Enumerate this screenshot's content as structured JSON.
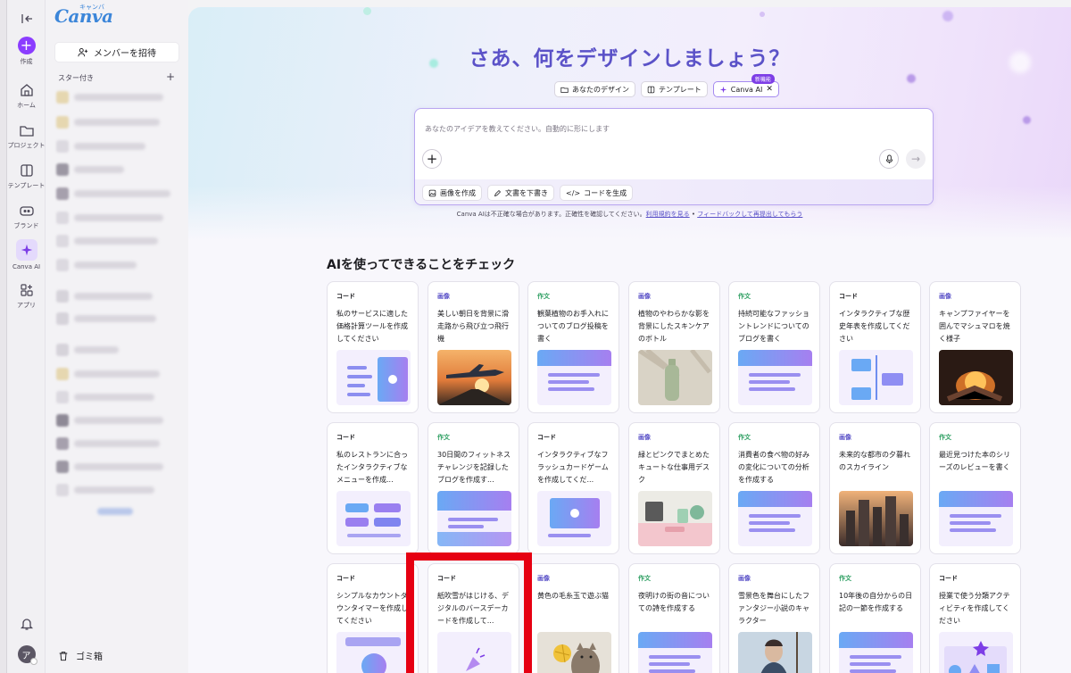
{
  "rail": {
    "create": "作成",
    "home": "ホーム",
    "projects": "プロジェクト",
    "templates": "テンプレート",
    "brand": "ブランド",
    "canva_ai": "Canva AI",
    "apps": "アプリ",
    "avatar_initial": "ア"
  },
  "panel": {
    "logo": "Canva",
    "logo_kana": "キャンバ",
    "invite": "メンバーを招待",
    "starred": "スター付き",
    "trash": "ゴミ箱"
  },
  "main": {
    "title": "さあ、何をデザインしましょう？",
    "chips": [
      {
        "label": "あなたのデザイン"
      },
      {
        "label": "テンプレート"
      },
      {
        "label": "Canva AI",
        "badge": "新機能"
      }
    ],
    "prompt": {
      "placeholder": "あなたのアイデアを教えてください。自動的に形にします",
      "tools": [
        "画像を作成",
        "文書を下書き",
        "コードを生成"
      ]
    },
    "disclaimer": {
      "text": "Canva AIは不正確な場合があります。正確性を確認してください。",
      "link1": "利用規約を見る",
      "sep": " • ",
      "link2": "フィードバックして再提出してもらう"
    },
    "section_title": "AIを使ってできることをチェック"
  },
  "colors": {
    "accent": "#8b3dff",
    "title": "#5b52c8",
    "code": "#1b1b1f",
    "image": "#5b52c8",
    "doc": "#2a9d5f",
    "highlight": "#e60012"
  },
  "cards": [
    {
      "cat": "コード",
      "kind": "code",
      "desc": "私のサービスに適した価格計算ツールを作成してください",
      "thumb": "calc"
    },
    {
      "cat": "画像",
      "kind": "img",
      "desc": "美しい朝日を背景に滑走路から飛び立つ飛行機",
      "thumb": "plane"
    },
    {
      "cat": "作文",
      "kind": "doc",
      "desc": "観葉植物のお手入れについてのブログ投稿を書く",
      "thumb": "doc"
    },
    {
      "cat": "画像",
      "kind": "img",
      "desc": "植物のやわらかな影を背景にしたスキンケアのボトル",
      "thumb": "bottle"
    },
    {
      "cat": "作文",
      "kind": "doc",
      "desc": "持続可能なファッショントレンドについてのブログを書く",
      "thumb": "doc"
    },
    {
      "cat": "コード",
      "kind": "code",
      "desc": "インタラクティブな歴史年表を作成してください",
      "thumb": "timeline"
    },
    {
      "cat": "画像",
      "kind": "img",
      "desc": "キャンプファイヤーを囲んでマシュマロを焼く様子",
      "thumb": "fire"
    },
    {
      "cat": "コード",
      "kind": "code",
      "desc": "私のレストランに合ったインタラクティブなメニューを作成...",
      "thumb": "menu"
    },
    {
      "cat": "作文",
      "kind": "doc",
      "desc": "30日間のフィットネスチャレンジを記録したブログを作成す...",
      "thumb": "doc2"
    },
    {
      "cat": "コード",
      "kind": "code",
      "desc": "インタラクティブなフラッシュカードゲームを作成してくだ...",
      "thumb": "flash"
    },
    {
      "cat": "画像",
      "kind": "img",
      "desc": "緑とピンクでまとめたキュートな仕事用デスク",
      "thumb": "desk"
    },
    {
      "cat": "作文",
      "kind": "doc",
      "desc": "消費者の食べ物の好みの変化についての分析を作成する",
      "thumb": "doc"
    },
    {
      "cat": "画像",
      "kind": "img",
      "desc": "未来的な都市の夕暮れのスカイライン",
      "thumb": "city"
    },
    {
      "cat": "作文",
      "kind": "doc",
      "desc": "最近見つけた本のシリーズのレビューを書く",
      "thumb": "doc"
    },
    {
      "cat": "コード",
      "kind": "code",
      "desc": "シンプルなカウントダウンタイマーを作成してください",
      "thumb": "timer"
    },
    {
      "cat": "コード",
      "kind": "code",
      "desc": "紙吹雪がはじける、デジタルのバースデーカードを作成して...",
      "thumb": "confetti"
    },
    {
      "cat": "画像",
      "kind": "img",
      "desc": "黄色の毛糸玉で遊ぶ猫",
      "thumb": "cat"
    },
    {
      "cat": "作文",
      "kind": "doc",
      "desc": "夜明けの街の音についての詩を作成する",
      "thumb": "doc"
    },
    {
      "cat": "画像",
      "kind": "img",
      "desc": "雪景色を舞台にしたファンタジー小説のキャラクター",
      "thumb": "snow"
    },
    {
      "cat": "作文",
      "kind": "doc",
      "desc": "10年後の自分からの日記の一節を作成する",
      "thumb": "doc"
    },
    {
      "cat": "コード",
      "kind": "code",
      "desc": "授業で使う分類アクティビティを作成してください",
      "thumb": "shapes"
    }
  ]
}
